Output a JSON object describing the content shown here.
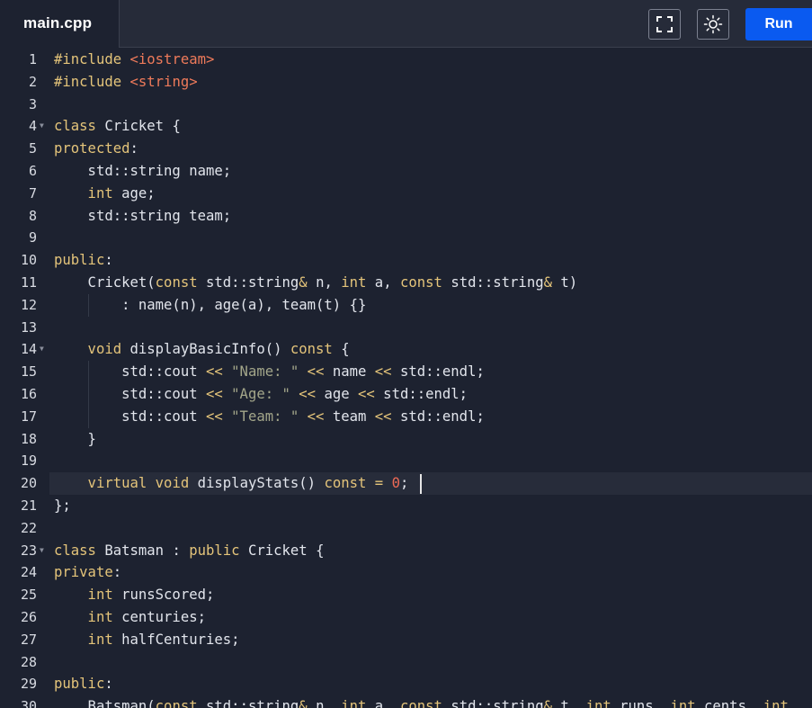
{
  "tab": {
    "filename": "main.cpp"
  },
  "toolbar": {
    "fullscreen_icon": "fullscreen-icon",
    "theme_icon": "sun-icon",
    "run_label": "Run",
    "run_color": "#0a5af0"
  },
  "editor": {
    "active_line": 20,
    "fold_lines": [
      4,
      14,
      23
    ],
    "lines": [
      [
        [
          "kw",
          "#include "
        ],
        [
          "str",
          "<iostream>"
        ]
      ],
      [
        [
          "kw",
          "#include "
        ],
        [
          "str",
          "<string>"
        ]
      ],
      [],
      [
        [
          "kw",
          "class"
        ],
        [
          "id",
          " Cricket {"
        ]
      ],
      [
        [
          "kw",
          "protected"
        ],
        [
          "id",
          ":"
        ]
      ],
      [
        [
          "id",
          "    std::string name;"
        ]
      ],
      [
        [
          "kw",
          "    int"
        ],
        [
          "id",
          " age;"
        ]
      ],
      [
        [
          "id",
          "    std::string team;"
        ]
      ],
      [],
      [
        [
          "kw",
          "public"
        ],
        [
          "id",
          ":"
        ]
      ],
      [
        [
          "id",
          "    Cricket("
        ],
        [
          "kw",
          "const"
        ],
        [
          "id",
          " std::string"
        ],
        [
          "op",
          "&"
        ],
        [
          "id",
          " n, "
        ],
        [
          "kw",
          "int"
        ],
        [
          "id",
          " a, "
        ],
        [
          "kw",
          "const"
        ],
        [
          "id",
          " std::string"
        ],
        [
          "op",
          "&"
        ],
        [
          "id",
          " t)"
        ]
      ],
      [
        [
          "id",
          "        : name(n), age(a), team(t) {}"
        ]
      ],
      [],
      [
        [
          "kw",
          "    void"
        ],
        [
          "id",
          " displayBasicInfo() "
        ],
        [
          "kw",
          "const"
        ],
        [
          "id",
          " {"
        ]
      ],
      [
        [
          "id",
          "        std::cout "
        ],
        [
          "op",
          "<<"
        ],
        [
          "id",
          " "
        ],
        [
          "sq",
          "\"Name: \""
        ],
        [
          "id",
          " "
        ],
        [
          "op",
          "<<"
        ],
        [
          "id",
          " name "
        ],
        [
          "op",
          "<<"
        ],
        [
          "id",
          " std::endl;"
        ]
      ],
      [
        [
          "id",
          "        std::cout "
        ],
        [
          "op",
          "<<"
        ],
        [
          "id",
          " "
        ],
        [
          "sq",
          "\"Age: \""
        ],
        [
          "id",
          " "
        ],
        [
          "op",
          "<<"
        ],
        [
          "id",
          " age "
        ],
        [
          "op",
          "<<"
        ],
        [
          "id",
          " std::endl;"
        ]
      ],
      [
        [
          "id",
          "        std::cout "
        ],
        [
          "op",
          "<<"
        ],
        [
          "id",
          " "
        ],
        [
          "sq",
          "\"Team: \""
        ],
        [
          "id",
          " "
        ],
        [
          "op",
          "<<"
        ],
        [
          "id",
          " team "
        ],
        [
          "op",
          "<<"
        ],
        [
          "id",
          " std::endl;"
        ]
      ],
      [
        [
          "id",
          "    }"
        ]
      ],
      [],
      [
        [
          "kw",
          "    virtual"
        ],
        [
          "kw",
          " void"
        ],
        [
          "id",
          " displayStats() "
        ],
        [
          "kw",
          "const"
        ],
        [
          "id",
          " "
        ],
        [
          "op",
          "="
        ],
        [
          "id",
          " "
        ],
        [
          "num",
          "0"
        ],
        [
          "id",
          ";"
        ]
      ],
      [
        [
          "id",
          "};"
        ]
      ],
      [],
      [
        [
          "kw",
          "class"
        ],
        [
          "id",
          " Batsman : "
        ],
        [
          "kw",
          "public"
        ],
        [
          "id",
          " Cricket {"
        ]
      ],
      [
        [
          "kw",
          "private"
        ],
        [
          "id",
          ":"
        ]
      ],
      [
        [
          "kw",
          "    int"
        ],
        [
          "id",
          " runsScored;"
        ]
      ],
      [
        [
          "kw",
          "    int"
        ],
        [
          "id",
          " centuries;"
        ]
      ],
      [
        [
          "kw",
          "    int"
        ],
        [
          "id",
          " halfCenturies;"
        ]
      ],
      [],
      [
        [
          "kw",
          "public"
        ],
        [
          "id",
          ":"
        ]
      ],
      [
        [
          "id",
          "    Batsman("
        ],
        [
          "kw",
          "const"
        ],
        [
          "id",
          " std::string"
        ],
        [
          "op",
          "&"
        ],
        [
          "id",
          " n, "
        ],
        [
          "kw",
          "int"
        ],
        [
          "id",
          " a, "
        ],
        [
          "kw",
          "const"
        ],
        [
          "id",
          " std::string"
        ],
        [
          "op",
          "&"
        ],
        [
          "id",
          " t, "
        ],
        [
          "kw",
          "int"
        ],
        [
          "id",
          " runs, "
        ],
        [
          "kw",
          "int"
        ],
        [
          "id",
          " cents, "
        ],
        [
          "kw",
          "int"
        ]
      ]
    ]
  }
}
